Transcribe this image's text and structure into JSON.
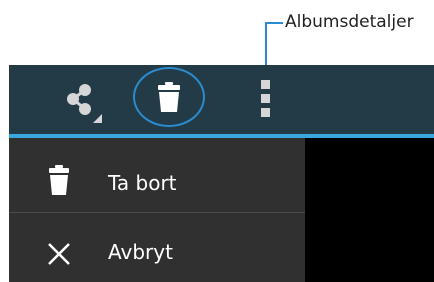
{
  "annotation": {
    "label": "Albumsdetaljer"
  },
  "action_bar": {
    "icons": {
      "share": "share-icon",
      "delete": "trash-icon",
      "overflow": "overflow-menu-icon"
    }
  },
  "menu": {
    "items": [
      {
        "label": "Ta bort",
        "icon": "trash-icon"
      },
      {
        "label": "Avbryt",
        "icon": "close-icon"
      }
    ]
  },
  "colors": {
    "action_bar_bg": "#233b47",
    "accent": "#3aa7de",
    "menu_bg": "#303030",
    "callout": "#2a8ccf"
  }
}
